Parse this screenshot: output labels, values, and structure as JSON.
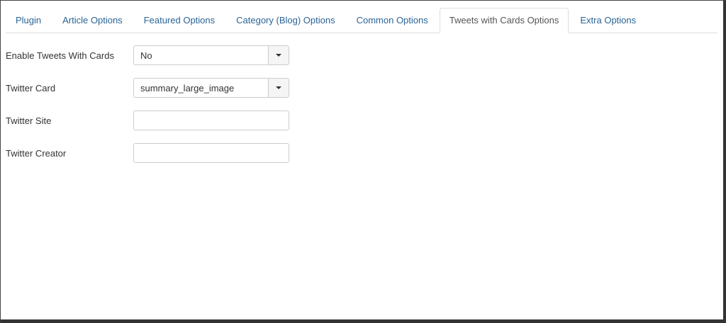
{
  "tabs": [
    {
      "label": "Plugin",
      "active": false
    },
    {
      "label": "Article Options",
      "active": false
    },
    {
      "label": "Featured Options",
      "active": false
    },
    {
      "label": "Category (Blog) Options",
      "active": false
    },
    {
      "label": "Common Options",
      "active": false
    },
    {
      "label": "Tweets with Cards Options",
      "active": true
    },
    {
      "label": "Extra Options",
      "active": false
    }
  ],
  "form": {
    "enable_tweets": {
      "label": "Enable Tweets With Cards",
      "value": "No",
      "icon": "chevron-down-icon"
    },
    "twitter_card": {
      "label": "Twitter Card",
      "value": "summary_large_image",
      "icon": "chevron-down-icon"
    },
    "twitter_site": {
      "label": "Twitter Site",
      "value": "",
      "placeholder": ""
    },
    "twitter_creator": {
      "label": "Twitter Creator",
      "value": "",
      "placeholder": ""
    }
  },
  "colors": {
    "link": "#2a6496",
    "active_tab_text": "#555555",
    "border": "#cccccc"
  }
}
